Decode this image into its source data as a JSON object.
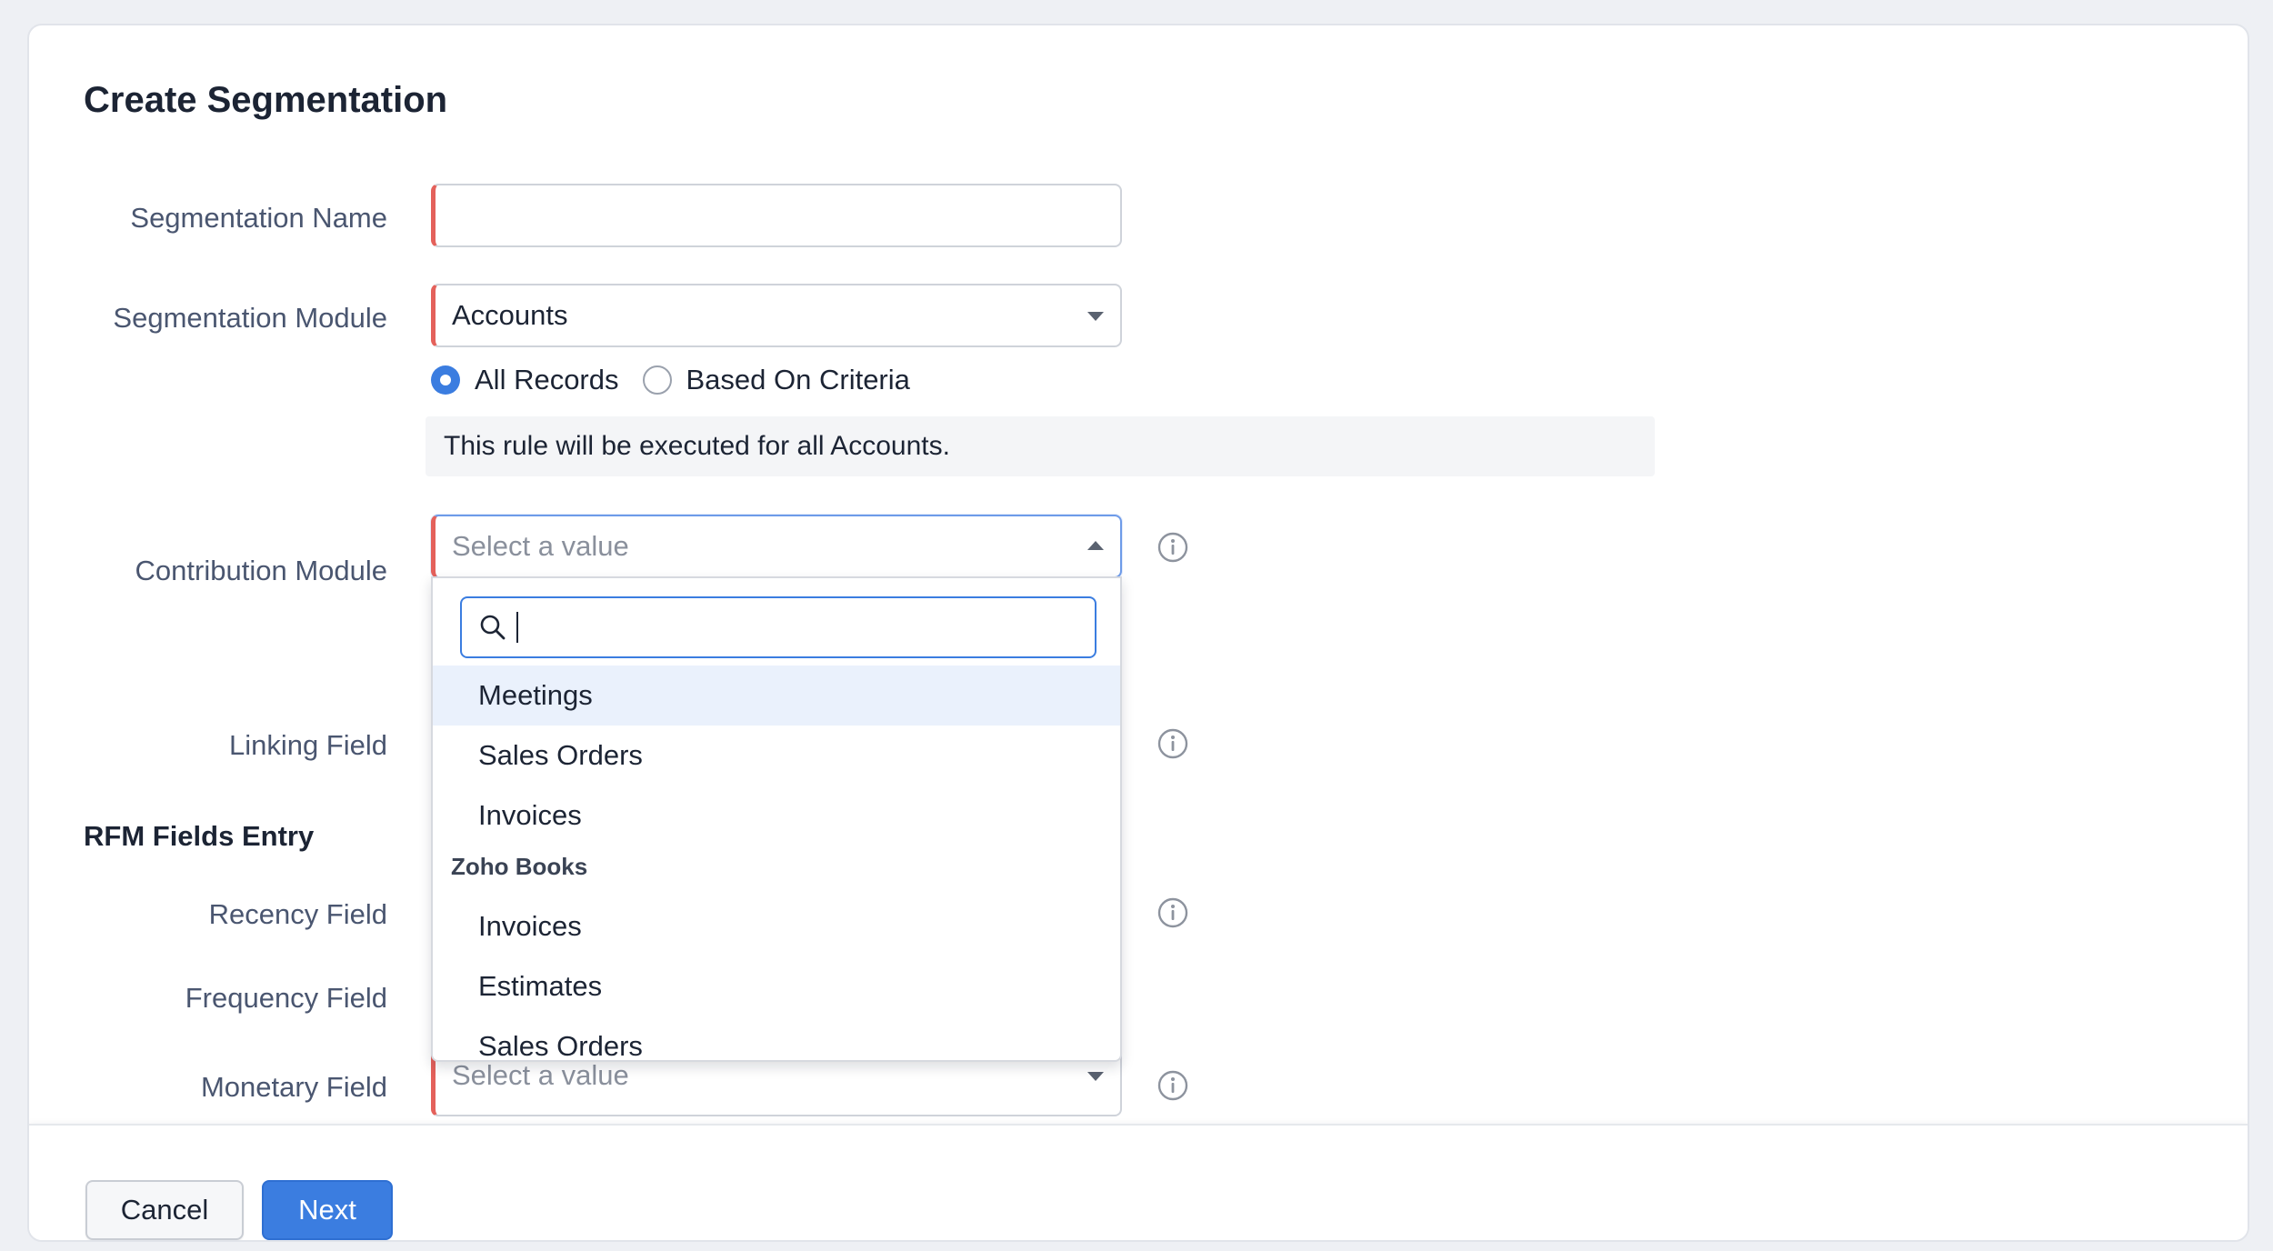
{
  "page": {
    "title": "Create Segmentation"
  },
  "form": {
    "segmentation_name": {
      "label": "Segmentation Name",
      "value": ""
    },
    "segmentation_module": {
      "label": "Segmentation Module",
      "value": "Accounts"
    },
    "record_scope": {
      "options": [
        {
          "label": "All Records",
          "selected": true
        },
        {
          "label": "Based On Criteria",
          "selected": false
        }
      ],
      "notice": "This rule will be executed for all Accounts."
    },
    "contribution_module": {
      "label": "Contribution Module",
      "placeholder": "Select a value",
      "dropdown": {
        "search_value": "",
        "items": [
          {
            "label": "Meetings",
            "highlighted": true
          },
          {
            "label": "Sales Orders"
          },
          {
            "label": "Invoices"
          }
        ],
        "group_label": "Zoho Books",
        "group_items": [
          "Invoices",
          "Estimates",
          "Sales Orders"
        ]
      }
    },
    "linking_field": {
      "label": "Linking Field"
    },
    "rfm_section_title": "RFM Fields Entry",
    "recency_field": {
      "label": "Recency Field"
    },
    "frequency_field": {
      "label": "Frequency Field"
    },
    "monetary_field": {
      "label": "Monetary Field",
      "placeholder": "Select a value"
    }
  },
  "footer": {
    "cancel_label": "Cancel",
    "next_label": "Next"
  },
  "colors": {
    "accent": "#3b7de0",
    "required_marker": "#e4615b",
    "hover_bg": "#eaf1fc"
  },
  "icons": {
    "info": "info-circle-icon",
    "search": "search-icon",
    "caret": "caret-icon"
  }
}
